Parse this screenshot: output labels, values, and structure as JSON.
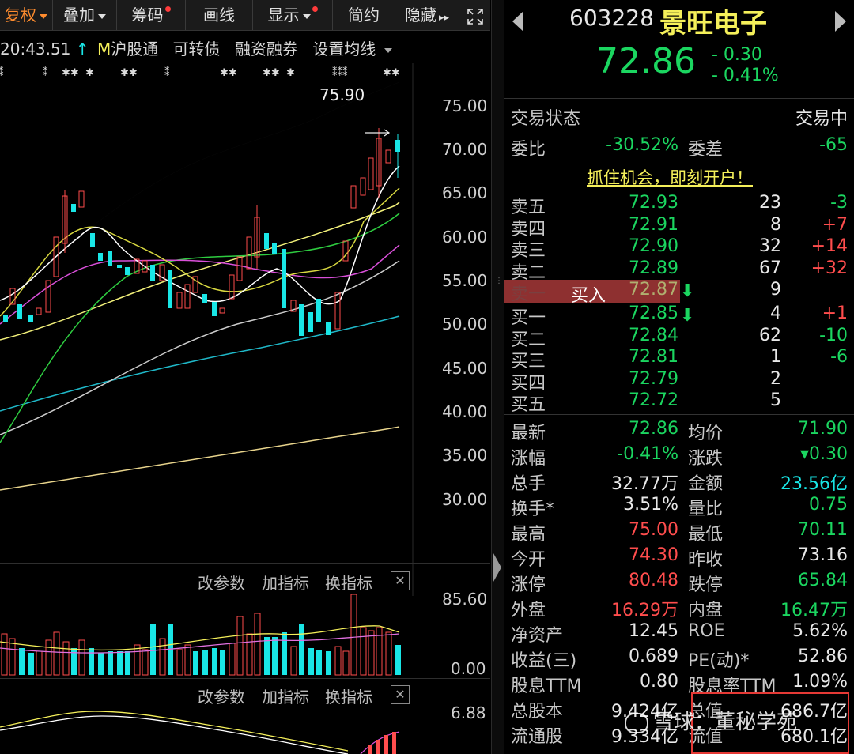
{
  "toolbar": {
    "items": [
      {
        "label": "复权",
        "caret": true,
        "dot": false
      },
      {
        "label": "叠加",
        "caret": true,
        "dot": false
      },
      {
        "label": "筹码",
        "caret": false,
        "dot": true
      },
      {
        "label": "画线",
        "caret": false,
        "dot": false
      },
      {
        "label": "显示",
        "caret": true,
        "dot": true
      },
      {
        "label": "简约",
        "caret": false,
        "dot": false
      },
      {
        "label": "隐藏",
        "caret": false,
        "dot": false
      }
    ],
    "hide_arrow": "▸▸",
    "expand_icon": "expand-icon"
  },
  "infobar": {
    "time": "20:43.51",
    "m_label": "M",
    "items": [
      "沪股通",
      "可转债",
      "融资融券",
      "设置均线"
    ]
  },
  "main_chart": {
    "high_marker": "75.90",
    "y_labels": [
      "75.00",
      "70.00",
      "65.00",
      "60.00",
      "55.00",
      "50.00",
      "45.00",
      "40.00",
      "35.00",
      "30.00"
    ]
  },
  "sub_chart1": {
    "buttons": [
      "改参数",
      "加指标",
      "换指标"
    ],
    "y_top": "85.60",
    "y_bottom": "0.00"
  },
  "sub_chart2": {
    "buttons": [
      "改参数",
      "加指标",
      "换指标"
    ],
    "y_top": "6.88"
  },
  "header": {
    "code": "603228",
    "name": "景旺电子",
    "price": "72.86",
    "change": "- 0.30",
    "change_pct": "- 0.41%"
  },
  "status": {
    "label": "交易状态",
    "value": "交易中"
  },
  "weibi": {
    "label": "委比",
    "value": "-30.52%",
    "diff_label": "委差",
    "diff_value": "-65"
  },
  "promo": "抓住机会，即刻开户！",
  "sell_orders": [
    {
      "label": "卖五",
      "price": "72.93",
      "vol": "23",
      "chg": "-3"
    },
    {
      "label": "卖四",
      "price": "72.91",
      "vol": "8",
      "chg": "+7"
    },
    {
      "label": "卖三",
      "price": "72.90",
      "vol": "32",
      "chg": "+14"
    },
    {
      "label": "卖二",
      "price": "72.89",
      "vol": "67",
      "chg": "+32"
    },
    {
      "label": "卖一",
      "price": "72.87",
      "vol": "9",
      "chg": ""
    }
  ],
  "buy_button": "买入",
  "buy_orders": [
    {
      "label": "买一",
      "price": "72.85",
      "vol": "4",
      "chg": "+1"
    },
    {
      "label": "买二",
      "price": "72.84",
      "vol": "62",
      "chg": "-10"
    },
    {
      "label": "买三",
      "price": "72.81",
      "vol": "1",
      "chg": "-6"
    },
    {
      "label": "买四",
      "price": "72.79",
      "vol": "2",
      "chg": ""
    },
    {
      "label": "买五",
      "price": "72.72",
      "vol": "5",
      "chg": ""
    }
  ],
  "stats": [
    {
      "l1": "最新",
      "v1": "72.86",
      "l2": "均价",
      "v2": "71.90"
    },
    {
      "l1": "涨幅",
      "v1": "-0.41%",
      "l2": "涨跌",
      "v2": "▾0.30"
    },
    {
      "l1": "总手",
      "v1": "32.77万",
      "l2": "金额",
      "v2": "23.56亿"
    },
    {
      "l1": "换手*",
      "v1": "3.51%",
      "l2": "量比",
      "v2": "0.75"
    },
    {
      "l1": "最高",
      "v1": "75.00",
      "l2": "最低",
      "v2": "70.11"
    },
    {
      "l1": "今开",
      "v1": "74.30",
      "l2": "昨收",
      "v2": "73.16"
    },
    {
      "l1": "涨停",
      "v1": "80.48",
      "l2": "跌停",
      "v2": "65.84"
    },
    {
      "l1": "外盘",
      "v1": "16.29万",
      "l2": "内盘",
      "v2": "16.47万"
    },
    {
      "l1": "净资产",
      "v1": "12.45",
      "l2": "ROE",
      "v2": "5.62%"
    },
    {
      "l1": "收益(三)",
      "v1": "0.689",
      "l2": "PE(动)*",
      "v2": "52.86"
    },
    {
      "l1": "股息TTM",
      "v1": "0.80",
      "l2": "股息率TTM",
      "v2": "1.09%"
    },
    {
      "l1": "总股本",
      "v1": "9.424亿",
      "l2": "总值",
      "v2": "686.7亿"
    },
    {
      "l1": "流通股",
      "v1": "9.334亿",
      "l2": "流值",
      "v2": "680.1亿"
    }
  ],
  "stat_colors": [
    [
      "g",
      "g"
    ],
    [
      "g",
      "g"
    ],
    [
      "w",
      "c"
    ],
    [
      "w",
      "g"
    ],
    [
      "r",
      "g"
    ],
    [
      "r",
      "w"
    ],
    [
      "r",
      "g"
    ],
    [
      "r",
      "g"
    ],
    [
      "w",
      "w"
    ],
    [
      "w",
      "w"
    ],
    [
      "w",
      "w"
    ],
    [
      "w",
      "w"
    ],
    [
      "w",
      "w"
    ]
  ],
  "watermark": "雪球：董秘学苑",
  "colors": {
    "up": "#ff4d4d",
    "down": "#19e6e6",
    "green": "#1bd660",
    "highlight_box": "#e53935"
  }
}
